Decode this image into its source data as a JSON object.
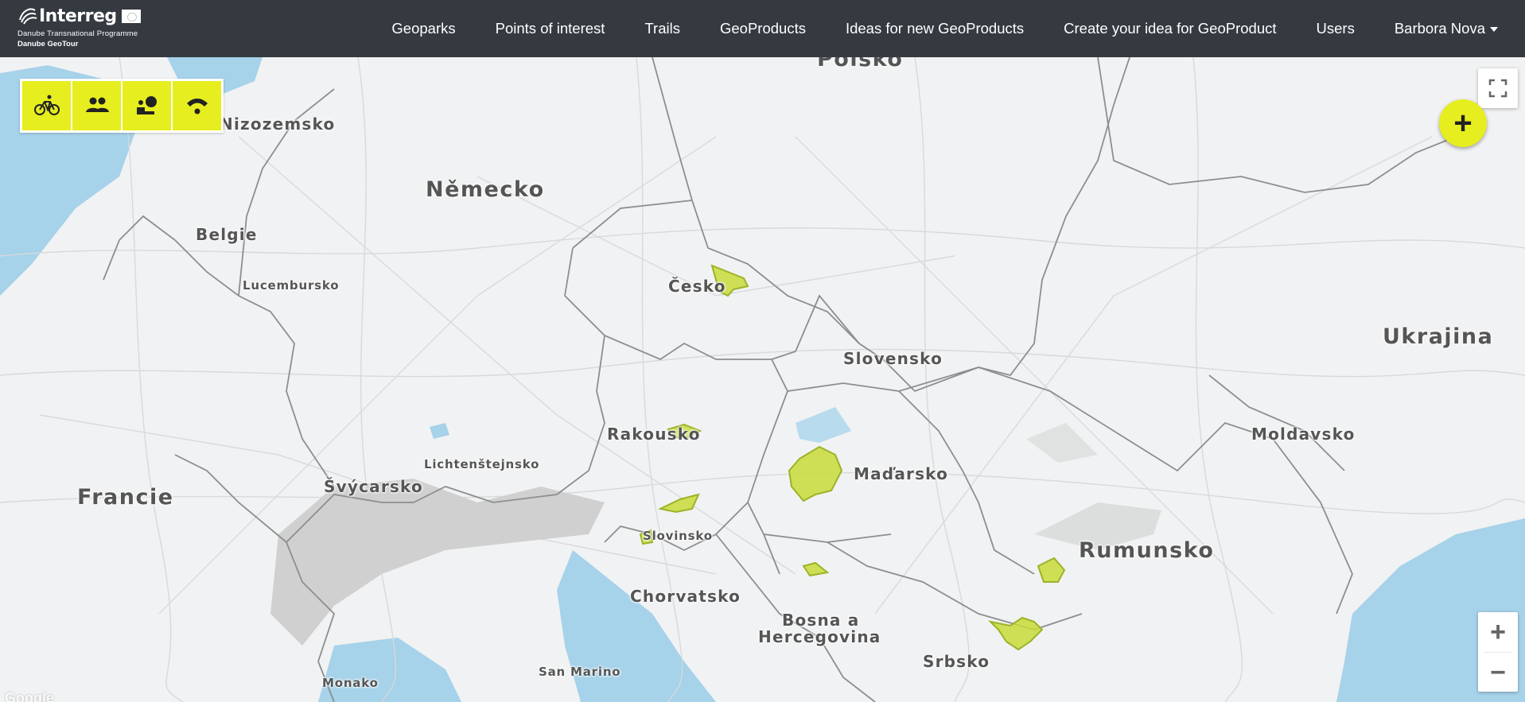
{
  "brand": {
    "title": "Interreg",
    "subtitle": "Danube Transnational Programme",
    "project": "Danube GeoTour"
  },
  "nav": {
    "items": [
      {
        "label": "Geoparks"
      },
      {
        "label": "Points of interest"
      },
      {
        "label": "Trails"
      },
      {
        "label": "GeoProducts"
      },
      {
        "label": "Ideas for new GeoProducts"
      },
      {
        "label": "Create your idea for GeoProduct"
      },
      {
        "label": "Users"
      }
    ],
    "user_name": "Barbora Nova"
  },
  "filters": [
    {
      "name": "bicycle-icon"
    },
    {
      "name": "people-icon"
    },
    {
      "name": "person-info-icon"
    },
    {
      "name": "signal-icon"
    }
  ],
  "colors": {
    "accent": "#e6ee1f",
    "navbar": "#343a40",
    "water": "#a6d2ea",
    "geopark_fill": "#c8dc3a",
    "geopark_stroke": "#9bb327"
  },
  "map": {
    "labels": {
      "polsko": "Polsko",
      "nizozemsko": "Nizozemsko",
      "nemecko": "Německo",
      "belgie": "Belgie",
      "lucembursko": "Lucembursko",
      "cesko": "Česko",
      "slovensko": "Slovensko",
      "ukrajina": "Ukrajina",
      "rakousko": "Rakousko",
      "lichtenstejnsko": "Lichtenštejnsko",
      "svycarsko": "Švýcarsko",
      "francie": "Francie",
      "madarsko": "Maďarsko",
      "moldavsko": "Moldavsko",
      "slovinsko": "Slovinsko",
      "rumunsko": "Rumunsko",
      "chorvatsko": "Chorvatsko",
      "bosna1": "Bosna a",
      "bosna2": "Hercegovina",
      "srbsko": "Srbsko",
      "san_marino": "San Marino",
      "monako": "Monako"
    },
    "attribution": "Google"
  },
  "controls": {
    "add_label": "+",
    "zoom_in": "+",
    "zoom_out": "−"
  }
}
